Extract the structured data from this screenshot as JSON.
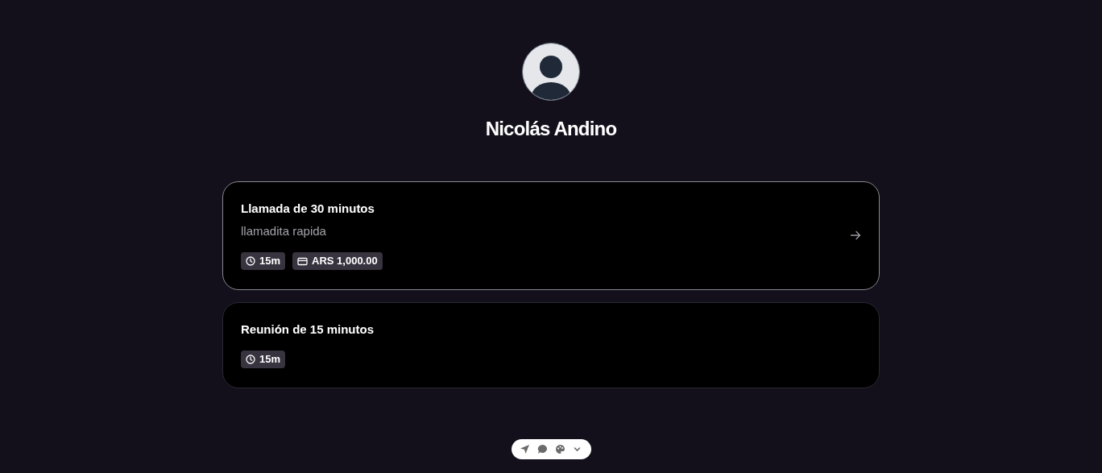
{
  "profile": {
    "name": "Nicolás Andino"
  },
  "event_types": [
    {
      "title": "Llamada de 30 minutos",
      "description": "llamadita rapida",
      "selected": true,
      "badges": [
        {
          "kind": "duration",
          "label": "15m"
        },
        {
          "kind": "price",
          "label": "ARS 1,000.00"
        }
      ]
    },
    {
      "title": "Reunión de 15 minutos",
      "selected": false,
      "badges": [
        {
          "kind": "duration",
          "label": "15m"
        }
      ]
    }
  ]
}
